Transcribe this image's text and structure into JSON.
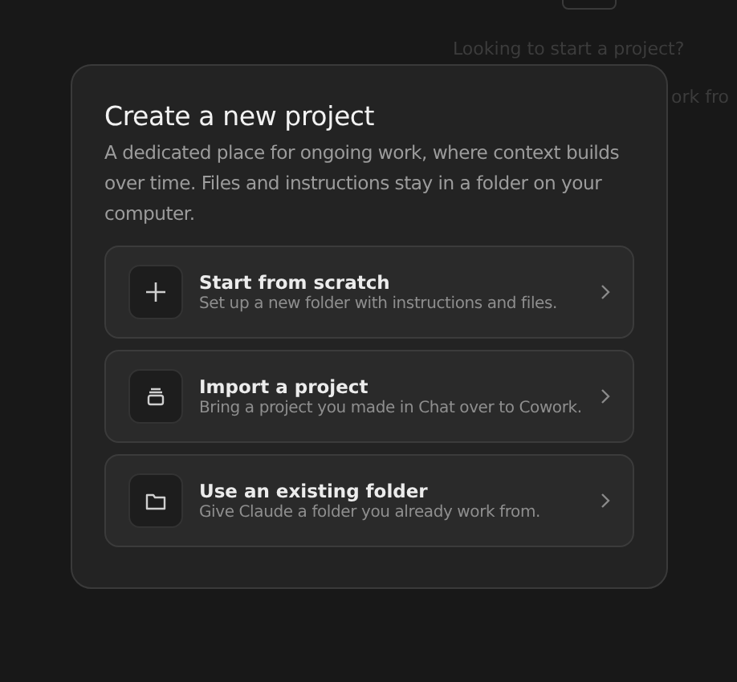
{
  "background": {
    "prompt": "Looking to start a project?",
    "hint_fragment": "ork fro"
  },
  "dialog": {
    "title": "Create a new project",
    "description": "A dedicated place for ongoing work, where context builds over time. Files and instructions stay in a folder on your computer.",
    "options": [
      {
        "kind": "plus",
        "title": "Start from scratch",
        "subtitle": "Set up a new folder with instructions and files."
      },
      {
        "kind": "import",
        "title": "Import a project",
        "subtitle": "Bring a project you made in Chat over to Cowork."
      },
      {
        "kind": "folder",
        "title": "Use an existing folder",
        "subtitle": "Give Claude a folder you already work from."
      }
    ]
  }
}
